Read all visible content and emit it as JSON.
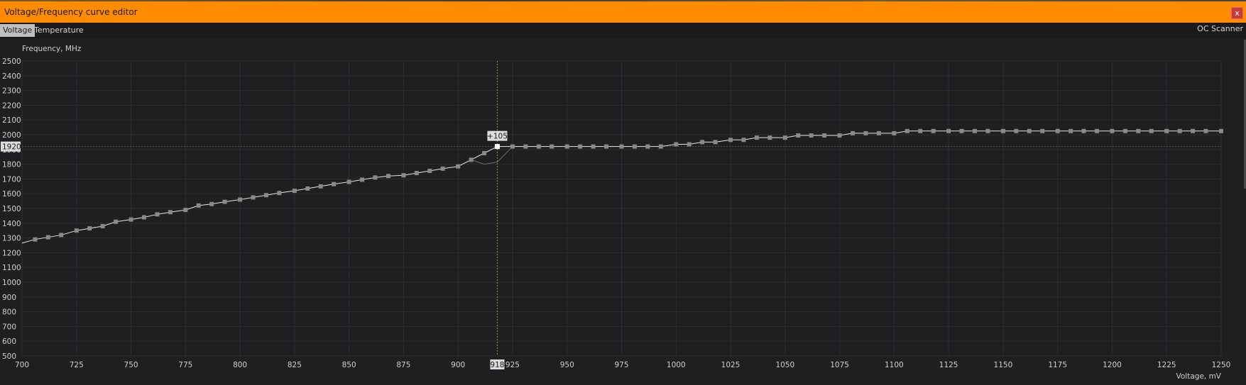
{
  "window": {
    "title": "Voltage/Frequency curve editor",
    "close_label": "x",
    "accent_color": "#ff8c00"
  },
  "tabs": [
    {
      "label": "Voltage",
      "active": true
    },
    {
      "label": "Temperature",
      "active": false
    }
  ],
  "oc_scanner_label": "OC Scanner",
  "chart_data": {
    "type": "line",
    "ylabel": "Frequency, MHz",
    "xlabel": "Voltage, mV",
    "xlim": [
      700,
      1250
    ],
    "ylim": [
      500,
      2500
    ],
    "x_ticks": [
      700,
      725,
      750,
      775,
      800,
      825,
      850,
      875,
      900,
      925,
      950,
      975,
      1000,
      1025,
      1050,
      1075,
      1100,
      1125,
      1150,
      1175,
      1200,
      1225,
      1250
    ],
    "y_ticks": [
      500,
      600,
      700,
      800,
      900,
      1000,
      1100,
      1200,
      1300,
      1400,
      1500,
      1600,
      1700,
      1800,
      1900,
      2000,
      2100,
      2200,
      2300,
      2400,
      2500
    ],
    "grid": true,
    "series": [
      {
        "x": [
          700,
          706,
          712,
          718,
          725,
          731,
          737,
          743,
          750,
          756,
          762,
          768,
          775,
          781,
          787,
          793,
          800,
          806,
          812,
          818,
          825,
          831,
          837,
          843,
          850,
          856,
          862,
          868,
          875,
          881,
          887,
          893,
          900,
          906,
          912,
          918,
          925,
          931,
          937,
          943,
          950,
          956,
          962,
          968,
          975,
          981,
          987,
          993,
          1000,
          1006,
          1012,
          1018,
          1025,
          1031,
          1037,
          1043,
          1050,
          1056,
          1062,
          1068,
          1075,
          1081,
          1087,
          1093,
          1100,
          1106,
          1112,
          1118,
          1125,
          1131,
          1137,
          1143,
          1150,
          1156,
          1162,
          1168,
          1175,
          1181,
          1187,
          1193,
          1200,
          1206,
          1212,
          1218,
          1225,
          1231,
          1237,
          1243,
          1250
        ],
        "y": [
          1265,
          1290,
          1305,
          1320,
          1350,
          1365,
          1380,
          1410,
          1425,
          1440,
          1460,
          1475,
          1490,
          1520,
          1530,
          1545,
          1560,
          1575,
          1590,
          1605,
          1620,
          1635,
          1650,
          1665,
          1680,
          1695,
          1710,
          1720,
          1725,
          1740,
          1755,
          1770,
          1785,
          1830,
          1875,
          1920,
          1920,
          1920,
          1920,
          1920,
          1920,
          1920,
          1920,
          1920,
          1920,
          1920,
          1920,
          1920,
          1935,
          1935,
          1950,
          1950,
          1965,
          1965,
          1980,
          1980,
          1980,
          1995,
          1995,
          1995,
          1995,
          2010,
          2010,
          2010,
          2010,
          2025,
          2025,
          2025,
          2025,
          2025,
          2025,
          2025,
          2025,
          2025,
          2025,
          2025,
          2025,
          2025,
          2025,
          2025,
          2025,
          2025,
          2025,
          2025,
          2025,
          2025,
          2025,
          2025,
          2025
        ]
      },
      {
        "x": [
          906,
          912,
          918,
          925
        ],
        "y": [
          1830,
          1800,
          1815,
          1920
        ]
      }
    ],
    "selected_point": {
      "x": 918,
      "y": 1920,
      "x_label": "918",
      "y_label": "1920",
      "offset_label": "+105"
    },
    "colors": {
      "background": "#1f1f21",
      "grid": "#2f2f33",
      "line": "#e6e6e6",
      "marker": "#8a8a8a",
      "selected_marker": "#ffffff",
      "cursor_vertical": "#8c9a2a",
      "cursor_horizontal": "#5a5a5a",
      "tick_text": "#d0d0d0",
      "highlight_label_bg": "#dcdcdc"
    }
  }
}
